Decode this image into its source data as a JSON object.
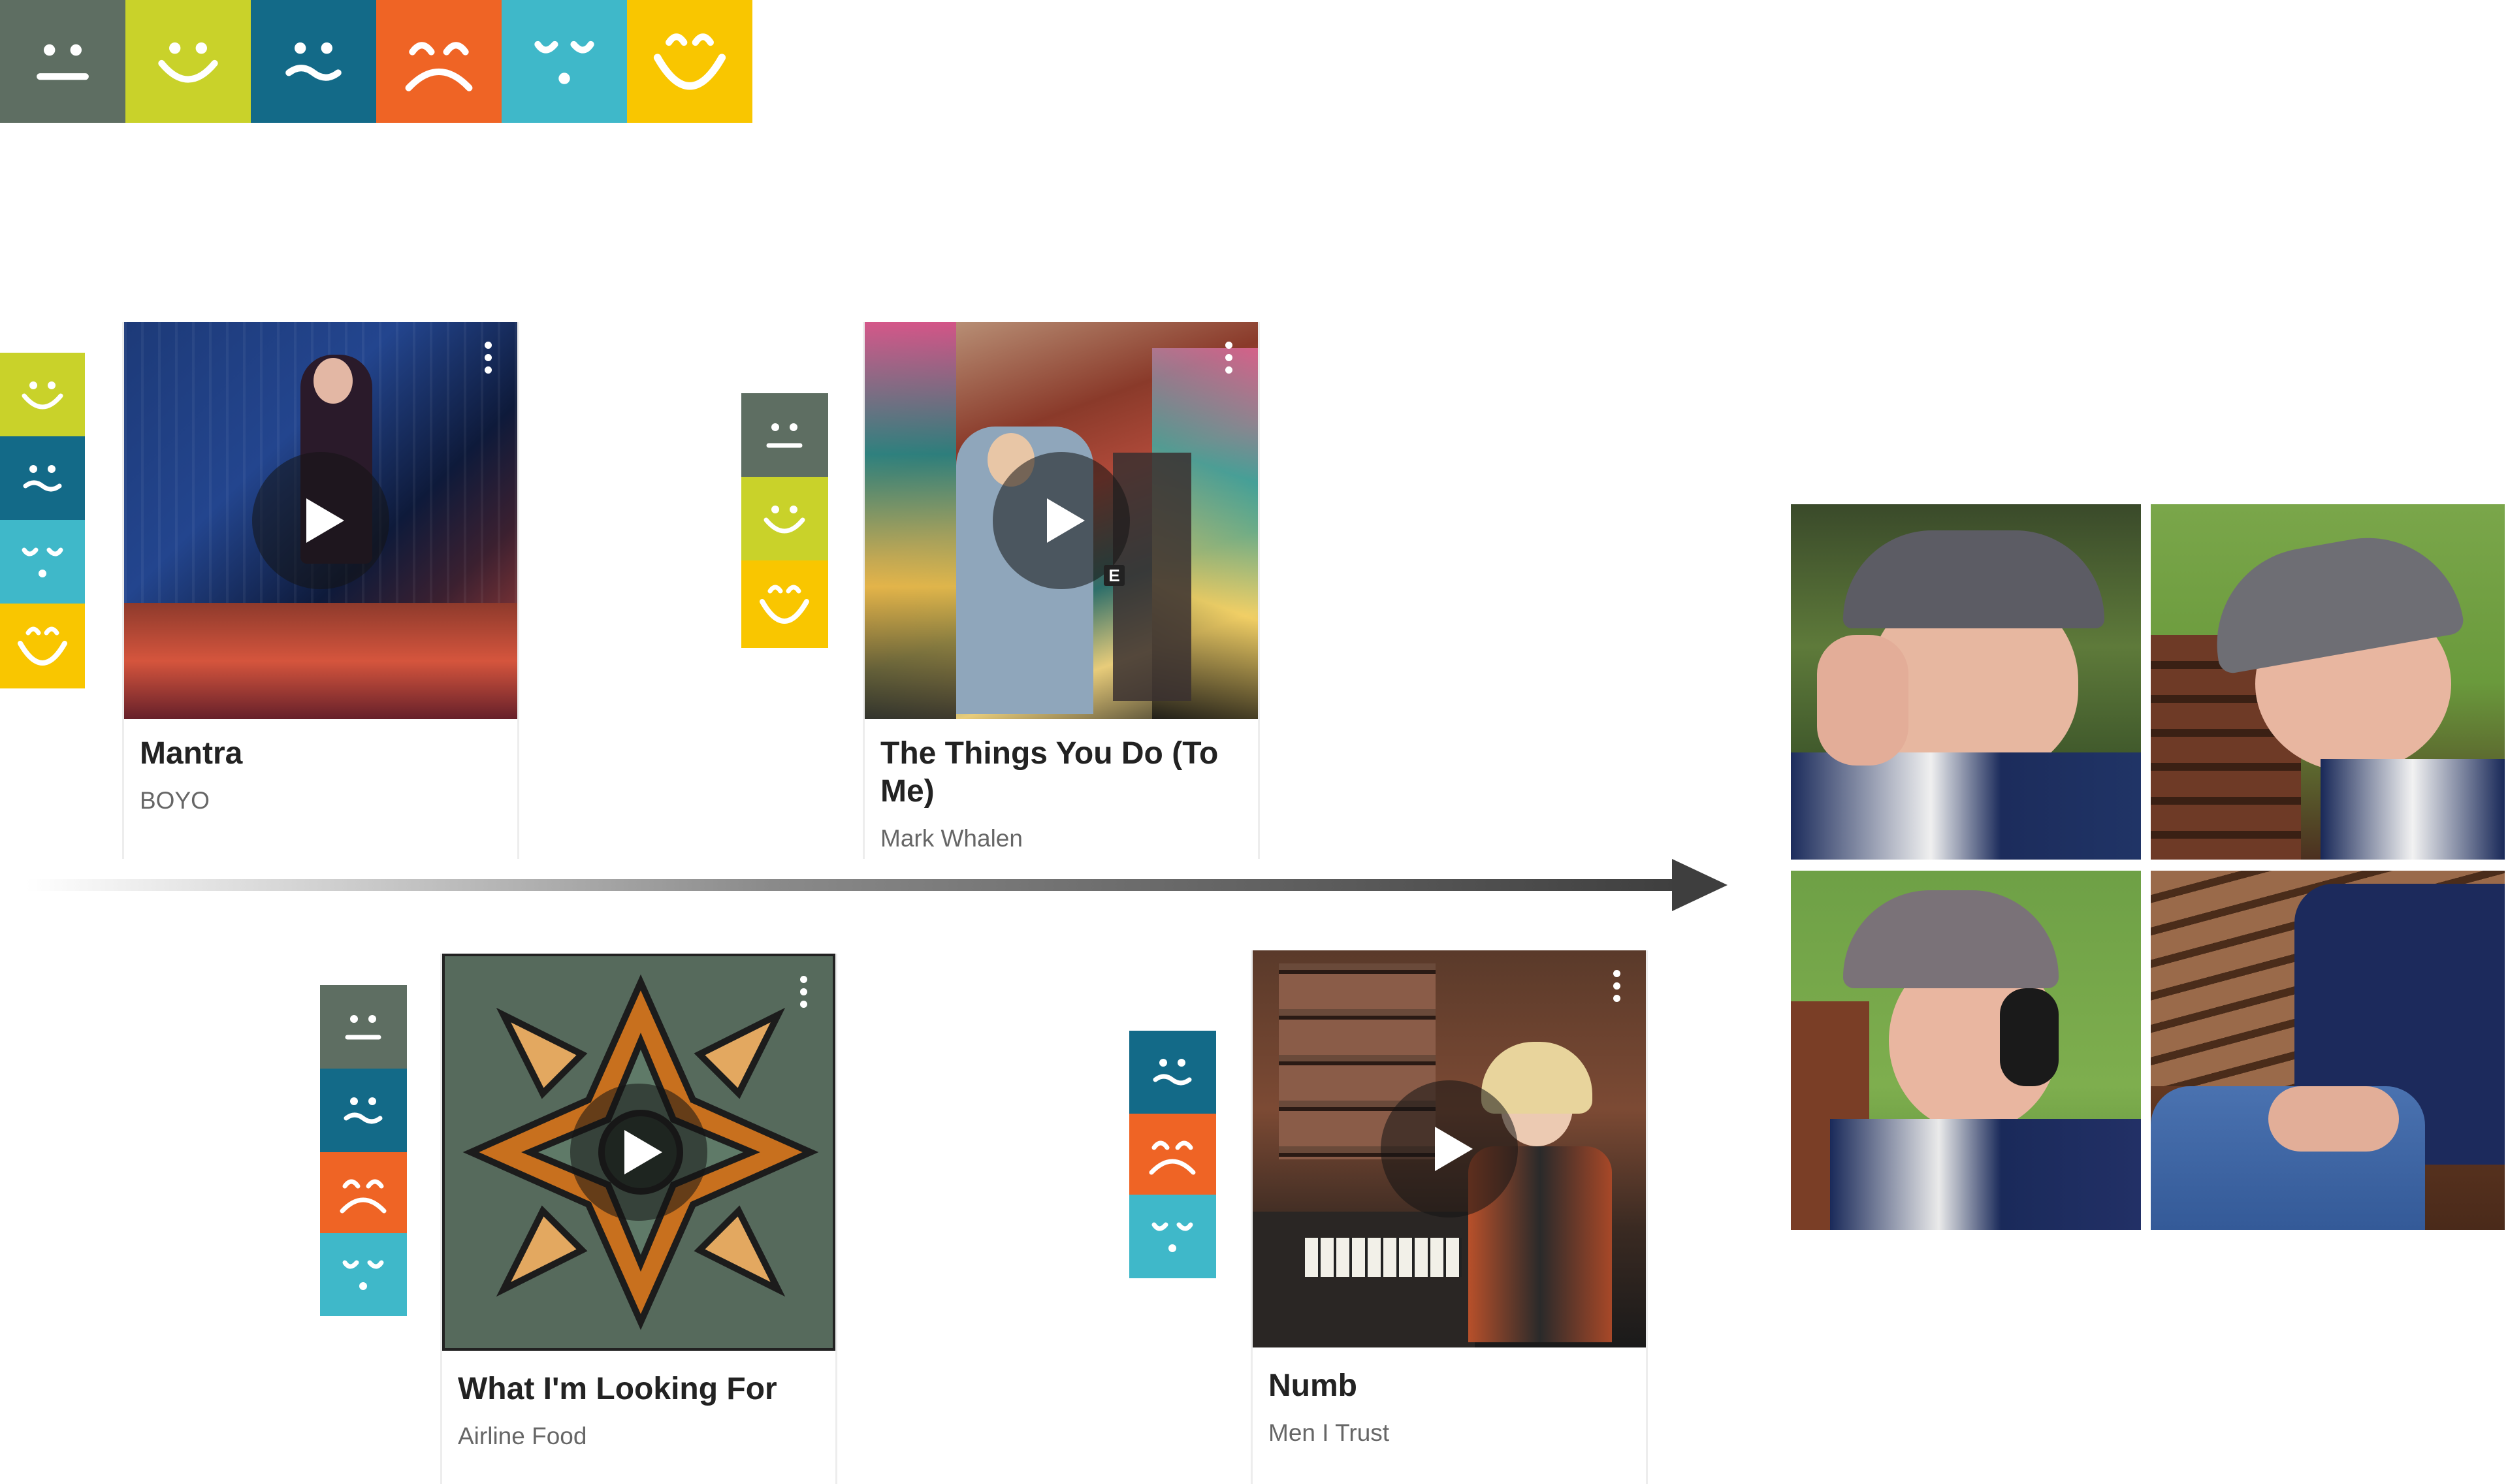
{
  "palette": {
    "neutral": "#5e6e62",
    "happy": "#c9d22a",
    "sad": "#136a88",
    "angry": "#ef6425",
    "calm": "#3fb8c9",
    "joyful": "#f9c600"
  },
  "legend_moods": [
    "neutral-face-icon",
    "smile-face-icon",
    "sad-face-icon",
    "frown-face-icon",
    "sleepy-face-icon",
    "big-smile-face-icon"
  ],
  "cards": [
    {
      "title": "Mantra",
      "artist": "BOYO",
      "moods": [
        "smile-face-icon",
        "sad-face-icon",
        "sleepy-face-icon",
        "big-smile-face-icon"
      ]
    },
    {
      "title": "The Things You Do (To Me)",
      "artist": "Mark Whalen",
      "moods": [
        "neutral-face-icon",
        "smile-face-icon",
        "big-smile-face-icon"
      ],
      "badge": "E"
    },
    {
      "title": "What I'm Looking For",
      "artist": "Airline Food",
      "moods": [
        "neutral-face-icon",
        "sad-face-icon",
        "frown-face-icon",
        "sleepy-face-icon"
      ]
    },
    {
      "title": "Numb",
      "artist": "Men I Trust",
      "moods": [
        "sad-face-icon",
        "frown-face-icon",
        "sleepy-face-icon"
      ]
    }
  ],
  "timeline": {
    "direction": "arrow-right-icon"
  }
}
